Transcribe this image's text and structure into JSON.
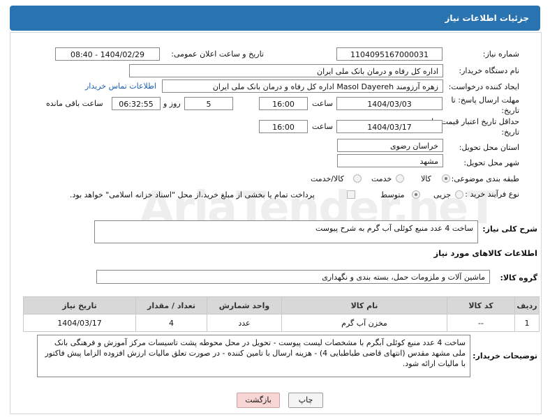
{
  "header": {
    "title": "جزئیات اطلاعات نیاز"
  },
  "fields": {
    "need_number_label": "شماره نیاز:",
    "need_number": "1104095167000031",
    "announce_label": "تاریخ و ساعت اعلان عمومی:",
    "announce_value": "1404/02/29 - 08:40",
    "buyer_org_label": "نام دستگاه خریدار:",
    "buyer_org": "اداره کل رفاه و درمان بانک ملی ایران",
    "requester_label": "ایجاد کننده درخواست:",
    "requester": "زهره آرزومند Masol Dayereh اداره کل رفاه و درمان بانک ملی ایران",
    "contact_link": "اطلاعات تماس خریدار",
    "reply_deadline_label": "مهلت ارسال پاسخ: تا تاریخ:",
    "reply_date": "1404/03/03",
    "time_label": "ساعت",
    "reply_time": "16:00",
    "days_value": "5",
    "days_label": "روز و",
    "remaining_time": "06:32:55",
    "remaining_label": "ساعت باقی مانده",
    "price_validity_label": "حداقل تاریخ اعتبار قیمت: تا تاریخ:",
    "price_date": "1404/03/17",
    "price_time": "16:00",
    "province_label": "استان محل تحویل:",
    "province": "خراسان رضوی",
    "city_label": "شهر محل تحویل:",
    "city": "مشهد",
    "category_label": "طبقه بندی موضوعی:",
    "category_options": [
      "کالا",
      "خدمت",
      "کالا/خدمت"
    ],
    "process_label": "نوع فرآیند خرید :",
    "process_options": [
      "جزیی",
      "متوسط"
    ],
    "payment_note": "پرداخت تمام یا بخشی از مبلغ خرید،از محل \"اسناد خزانه اسلامی\" خواهد بود."
  },
  "summary": {
    "label": "شرح کلی نیاز:",
    "text": "ساخت 4 عدد منبع کوئلی آب گرم به شرح پیوست"
  },
  "goods": {
    "section_title": "اطلاعات کالاهای مورد نیاز",
    "group_label": "گروه کالا:",
    "group_value": "ماشین آلات و ملزومات حمل، بسته بندی و نگهداری",
    "columns": [
      "ردیف",
      "کد کالا",
      "نام کالا",
      "واحد شمارش",
      "تعداد / مقدار",
      "تاریخ نیاز"
    ],
    "rows": [
      {
        "row": "1",
        "code": "--",
        "name": "مخزن آب گرم",
        "unit": "عدد",
        "qty": "4",
        "date": "1404/03/17"
      }
    ]
  },
  "buyer_notes": {
    "label": "توضیحات خریدار:",
    "text": "ساخت 4 عدد منبع کوئلی آبگرم با مشخصات لیست پیوست - تحویل در محل محوطه پشت تاسیسات مرکز آموزش و فرهنگی بانک ملی مشهد مقدس (انتهای قاضی طباطبایی 4) - هزینه ارسال با تامین کننده - در صورت تعلق مالیات ارزش افزوده الزاما پیش فاکتور با مالیات ارائه شود."
  },
  "buttons": {
    "print": "چاپ",
    "back": "بازگشت"
  },
  "watermark": "AriaTender.neT",
  "colors": {
    "header_bg": "#2a73b1",
    "link": "#1a5fb4",
    "back_button_bg": "#f9d6d6"
  }
}
